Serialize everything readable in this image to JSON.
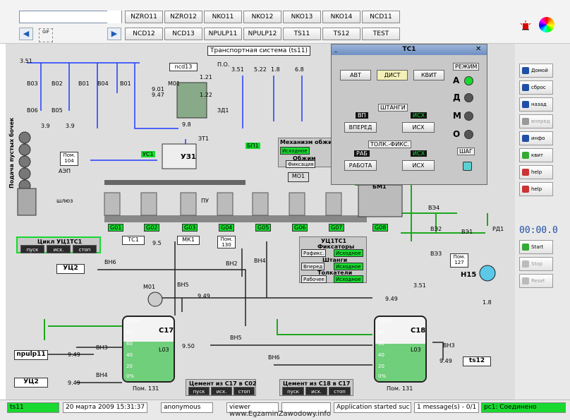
{
  "toolbar": {
    "row1": [
      "NZRO11",
      "NZRO12",
      "NKO11",
      "NKO12",
      "NKO13",
      "NKO14",
      "NCD11"
    ],
    "row2": [
      "NCD12",
      "NCD13",
      "NPULP11",
      "NPULP12",
      "TS11",
      "TS12",
      "TEST"
    ],
    "combo_value": "",
    "small_icon_text": "GIF"
  },
  "tooltip": "Транспортная система (ts11)",
  "right_panel": {
    "buttons": [
      "Домой",
      "сброс",
      "назад",
      "вперед",
      "инфо",
      "квит",
      "help",
      "help"
    ],
    "clock": "00:00.0",
    "sim_buttons": [
      "Start",
      "Stop",
      "Reset"
    ]
  },
  "dialog": {
    "title": "ТС1",
    "top_buttons": [
      "АВТ",
      "ДИСТ",
      "КВИТ"
    ],
    "mode_label": "РЕЖИМ",
    "modes": [
      "А",
      "Д",
      "М",
      "О"
    ],
    "section1": "ШТАНГИ",
    "vp": "ВП",
    "isx": "ИСХ",
    "s1_buttons": [
      "ВПЕРЕД",
      "ИСХ"
    ],
    "section2": "ТОЛК.-ФИКС.",
    "rab": "РАБ",
    "s2_buttons": [
      "РАБОТА",
      "ИСХ"
    ],
    "step_label": "ШАГ"
  },
  "scheme": {
    "pressures": [
      "3.51",
      "6.8",
      "1.8",
      "5.22",
      "3.9",
      "9.8",
      "9.5",
      "9.49",
      "9.50",
      "1.21",
      "1.22",
      "9.01",
      "9.47"
    ],
    "valves_top_left": [
      "В03",
      "В02",
      "В01",
      "В04",
      "В01",
      "В06",
      "В05"
    ],
    "labels": {
      "ncd13": "ncd13",
      "m01": "М01",
      "zt1": "ЗТ1",
      "uz1": "УЗ1",
      "us1": "УС1",
      "aep": "АЭП",
      "pom104": "Пом. 104",
      "shlyuz": "шлюз",
      "feed": "Подача пустых бочек",
      "po": "П.О.",
      "zd1": "ЗД1",
      "bp1": "БП1",
      "mo1": "МО1",
      "pu": "ПУ",
      "bm1": "БМ1",
      "ts1": "ТС1",
      "mk1": "МК1",
      "pom130": "Пом. 130",
      "pom127": "Пом. 127",
      "n15": "Н15",
      "rd1": "РД1",
      "ve1": "ВЭ1",
      "ve2": "ВЭ2",
      "ve3": "ВЭ3",
      "ve4": "ВЭ4",
      "c17": "С17",
      "c18": "С18",
      "l03": "L03",
      "pom131": "Пом. 131",
      "uc2": "УЦ2",
      "npulp11": "npulp11",
      "ts12": "ts12",
      "vn1": "ВН1",
      "vn2": "ВН2",
      "vn3": "ВН3",
      "vn4": "ВН4",
      "vn5": "ВН5",
      "vn6": "ВН6"
    },
    "conveyor_tags": [
      "G01",
      "G02",
      "G03",
      "G04",
      "G05",
      "G06",
      "G07",
      "G08"
    ],
    "mech_panel": {
      "title": "Механизм обжима",
      "state": "Исходное",
      "obzhim": "Обжим",
      "fix": "Фиксация"
    },
    "uc_panel": {
      "title": "УЦ1ТС1",
      "fix_title": "Фиксаторы",
      "fix_label": "Рафикс.",
      "fix_state": "Исходное",
      "rods_title": "Штанги",
      "rods_label": "Вперед",
      "rods_state": "Исходное",
      "push_title": "Толкатели",
      "push_label": "Рабочее",
      "push_state": "Исходное"
    },
    "cycle_panel": {
      "title": "Цикл УЦ1ТС1",
      "buttons": [
        "пуск",
        "исх.",
        "стоп"
      ]
    },
    "cement_c02": {
      "title": "Цемент из С17 в С02",
      "buttons": [
        "пуск",
        "исх.",
        "стоп"
      ]
    },
    "cement_c17": {
      "title": "Цемент из С18 в С17",
      "buttons": [
        "пуск",
        "исх.",
        "стоп"
      ]
    },
    "tank_scale": [
      "100%",
      "80",
      "60",
      "40",
      "20",
      "0%"
    ],
    "tank_level_c17": 0.62,
    "tank_level_c18": 0.58
  },
  "status": {
    "left": "ts11",
    "datetime": "20 марта 2009 15:31:37",
    "user": "anonymous",
    "viewer": "viewer",
    "blank": "",
    "message": "Application started suc",
    "count": "1 message(s) - 0/1",
    "conn": "pc1: Соединено"
  },
  "watermark": "www.EgzaminZawodowy.info",
  "colors": {
    "green": "#19d830",
    "pipe_blue": "#1e3cff",
    "pipe_green": "#1ea81e",
    "valve_purple": "#a020a0",
    "accent": "#1f4fa6"
  }
}
